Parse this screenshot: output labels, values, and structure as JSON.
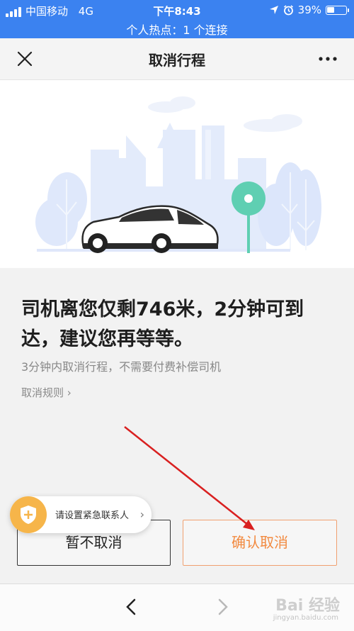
{
  "status_bar": {
    "carrier": "中国移动",
    "network": "4G",
    "time": "下午8:43",
    "battery": "39%",
    "battery_level": 0.39,
    "hotspot": "个人热点：1 个连接"
  },
  "navbar": {
    "title": "取消行程"
  },
  "main": {
    "headline": "司机离您仅剩746米，2分钟可到达，建议您再等等。",
    "subtext": "3分钟内取消行程，不需要付费补偿司机",
    "rules_link": "取消规则 ›"
  },
  "emergency": {
    "label": "请设置紧急联系人"
  },
  "buttons": {
    "keep": "暂不取消",
    "confirm": "确认取消"
  },
  "watermark": {
    "text": "Bai 经验",
    "url": "jingyan.baidu.com"
  },
  "colors": {
    "status_bar": "#3b82f0",
    "confirm_text": "#f28a40",
    "emergency_badge": "#f6b54a",
    "annotation_arrow": "#d92020"
  }
}
